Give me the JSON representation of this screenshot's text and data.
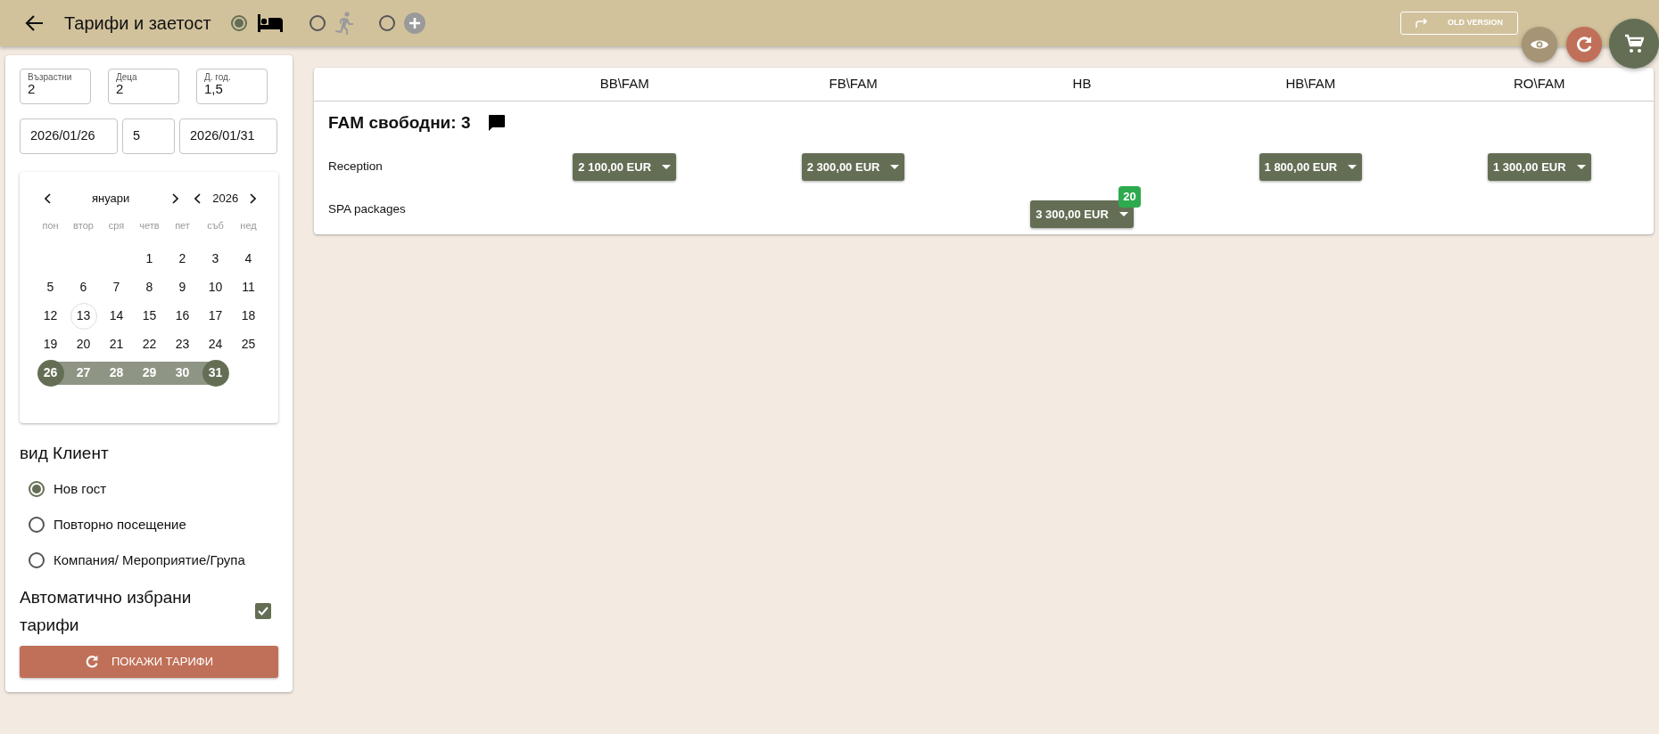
{
  "window": {
    "title": "Тарифи и заетост"
  },
  "modes": [
    {
      "kind": "bed",
      "selected": true,
      "disabled": false
    },
    {
      "kind": "run",
      "selected": false,
      "disabled": true
    },
    {
      "kind": "add",
      "selected": false,
      "disabled": true
    }
  ],
  "old_version_button": {
    "label": "OLD VERSION"
  },
  "guests": [
    {
      "label": "Възрастни",
      "value": "2"
    },
    {
      "label": "Деца",
      "value": "2"
    },
    {
      "label": "Д. год.",
      "value": "1,5"
    }
  ],
  "dates": [
    {
      "value": "2026/01/26"
    },
    {
      "value": "5"
    },
    {
      "value": "2026/01/31"
    }
  ],
  "calendar": {
    "month": "януари",
    "year": "2026",
    "weekdays": [
      "пон",
      "втор",
      "сря",
      "четв",
      "пет",
      "съб",
      "нед"
    ],
    "weeks": [
      {
        "days": [
          {
            "day": "1",
            "kind": "plain"
          },
          {
            "day": "2",
            "kind": "plain"
          },
          {
            "day": "3",
            "kind": "plain"
          },
          {
            "day": "4",
            "kind": "plain"
          }
        ]
      },
      {
        "days": [
          {
            "day": "5",
            "kind": "plain"
          },
          {
            "day": "6",
            "kind": "plain"
          },
          {
            "day": "7",
            "kind": "plain"
          },
          {
            "day": "8",
            "kind": "plain"
          },
          {
            "day": "9",
            "kind": "plain"
          },
          {
            "day": "10",
            "kind": "plain"
          },
          {
            "day": "11",
            "kind": "plain"
          }
        ]
      },
      {
        "days": [
          {
            "day": "12",
            "kind": "plain"
          },
          {
            "day": "13",
            "kind": "today"
          },
          {
            "day": "14",
            "kind": "plain"
          },
          {
            "day": "15",
            "kind": "plain"
          },
          {
            "day": "16",
            "kind": "plain"
          },
          {
            "day": "17",
            "kind": "plain"
          },
          {
            "day": "18",
            "kind": "plain"
          }
        ]
      },
      {
        "days": [
          {
            "day": "19",
            "kind": "plain"
          },
          {
            "day": "20",
            "kind": "plain"
          },
          {
            "day": "21",
            "kind": "plain"
          },
          {
            "day": "22",
            "kind": "plain"
          },
          {
            "day": "23",
            "kind": "plain"
          },
          {
            "day": "24",
            "kind": "plain"
          },
          {
            "day": "25",
            "kind": "plain"
          }
        ]
      },
      {
        "days": [
          {
            "day": "26",
            "kind": "range_start"
          },
          {
            "day": "27",
            "kind": "in_range"
          },
          {
            "day": "28",
            "kind": "in_range"
          },
          {
            "day": "29",
            "kind": "in_range"
          },
          {
            "day": "30",
            "kind": "in_range"
          },
          {
            "day": "31",
            "kind": "range_end"
          }
        ]
      }
    ]
  },
  "client_type": {
    "title": "вид Клиент",
    "options": [
      {
        "label": "Нов гост",
        "selected": true
      },
      {
        "label": "Повторно посещение",
        "selected": false
      },
      {
        "label": "Компания/ Мероприятие/Група",
        "selected": false
      }
    ]
  },
  "auto_rates": {
    "label": "Автоматично избрани тарифи",
    "checked": true
  },
  "show_rates_button": {
    "label": "ПОКАЖИ ТАРИФИ"
  },
  "table": {
    "columns": [
      "BB\\FAM",
      "FB\\FAM",
      "HB",
      "HB\\FAM",
      "RO\\FAM"
    ],
    "group_title": "FAM свободни: 3",
    "rows": [
      {
        "label": "Reception",
        "cells": [
          {
            "price": "2 100,00 EUR"
          },
          {
            "price": "2 300,00 EUR"
          },
          null,
          {
            "price": "1 800,00 EUR"
          },
          {
            "price": "1 300,00 EUR"
          }
        ]
      },
      {
        "label": "SPA packages",
        "cells": [
          null,
          null,
          {
            "price": "3 300,00 EUR",
            "badge": "20"
          },
          null,
          null
        ]
      }
    ]
  }
}
